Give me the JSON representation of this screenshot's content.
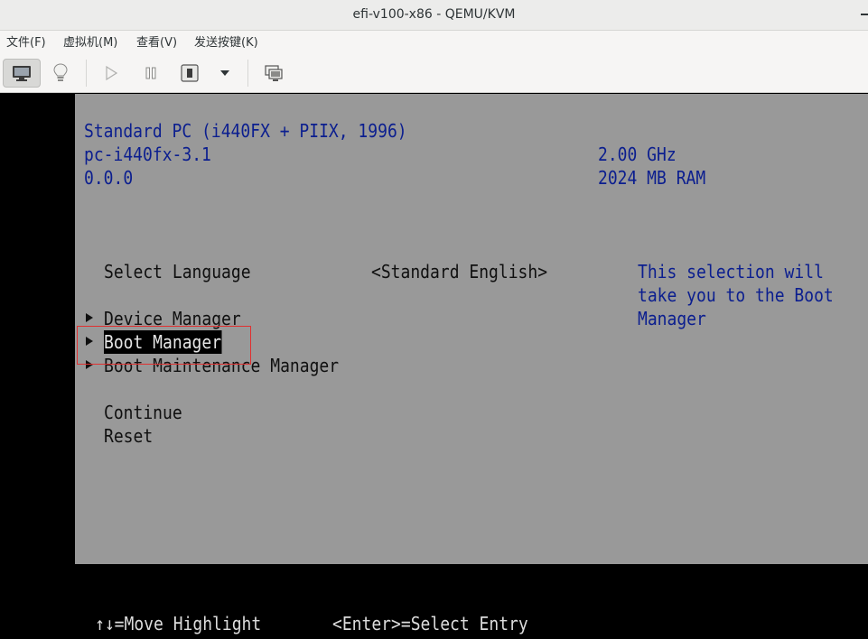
{
  "window": {
    "title": "efi-v100-x86 - QEMU/KVM"
  },
  "menu": {
    "items": [
      "文件(F)",
      "虚拟机(M)",
      "查看(V)",
      "发送按键(K)"
    ]
  },
  "toolbar": {
    "buttons": [
      "console-icon",
      "lightbulb-icon",
      "play-icon",
      "pause-icon",
      "power-icon",
      "dropdown-icon",
      "snapshot-icon"
    ]
  },
  "firmware": {
    "platform": "Standard PC (i440FX + PIIX, 1996)",
    "machine": "pc-i440fx-3.1",
    "version": "0.0.0",
    "cpu_speed": "2.00 GHz",
    "memory": "2024 MB RAM",
    "menu": {
      "select_language_label": "Select Language",
      "select_language_value": "<Standard English>",
      "device_manager": "Device Manager",
      "boot_manager": "Boot Manager",
      "boot_maintenance_manager": "Boot Maintenance Manager",
      "continue": "Continue",
      "reset": "Reset"
    },
    "help": {
      "line1": "This selection will",
      "line2": "take you to the Boot",
      "line3": "Manager"
    },
    "footer": {
      "move_highlight": "↑↓=Move Highlight",
      "select_entry": "<Enter>=Select Entry"
    }
  },
  "colors": {
    "panel_bg": "#999999",
    "text_blue": "#0b1e8f",
    "text_dark": "#101010",
    "highlight_bg": "#000000",
    "annotation_red": "#e03030"
  }
}
